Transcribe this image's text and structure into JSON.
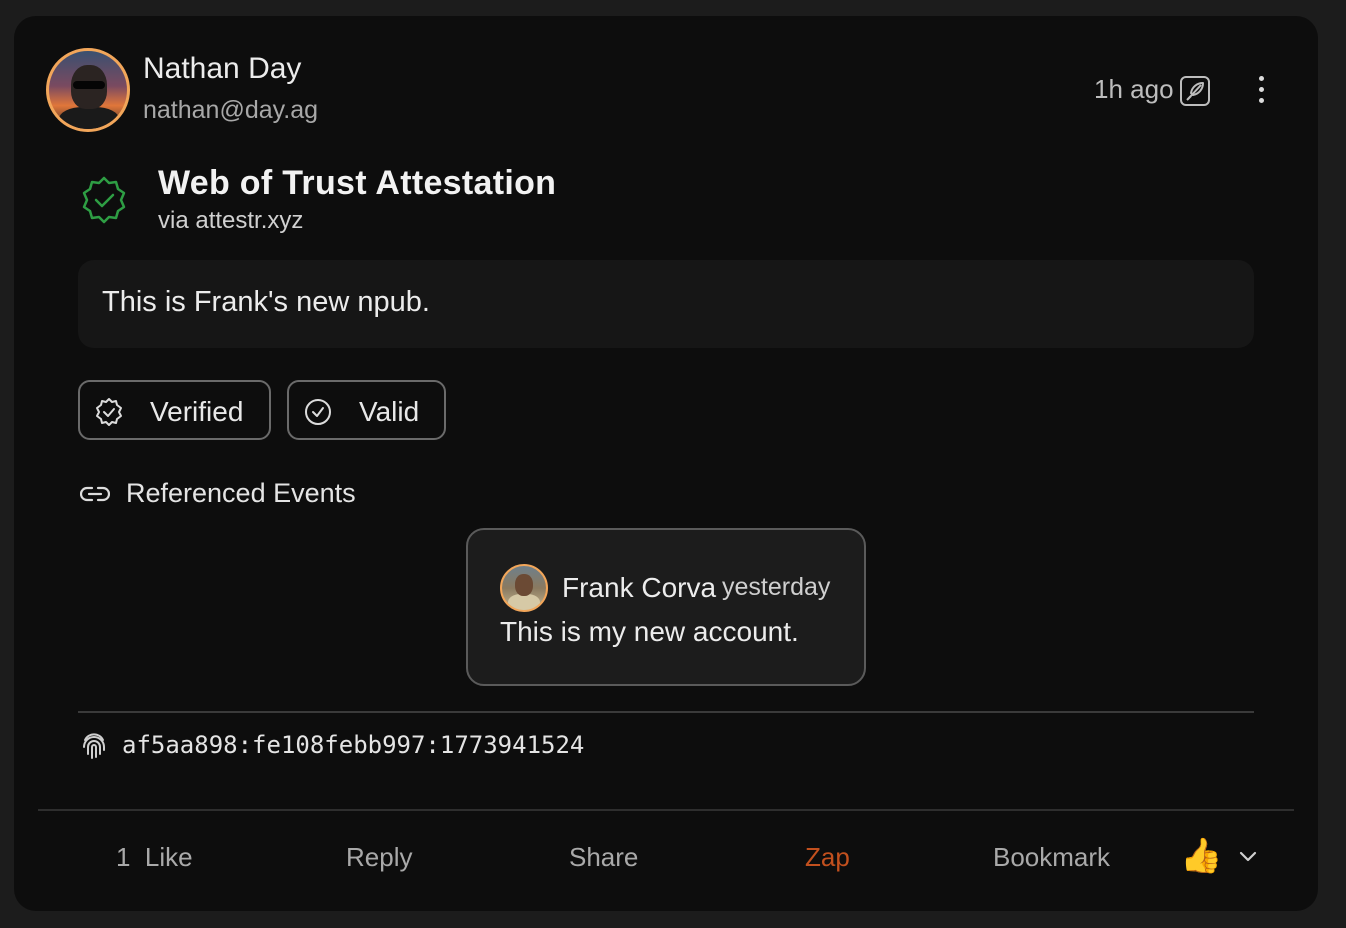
{
  "author": {
    "name": "Nathan Day",
    "nip05": "nathan@day.ag",
    "time": "1h ago",
    "avatar_icon": "user-avatar-photo"
  },
  "attestation": {
    "title": "Web of Trust Attestation",
    "via": "via attestr.xyz",
    "icon": "verified-badge-icon",
    "icon_color": "#2e9e44"
  },
  "content": "This is Frank's new npub.",
  "chips": {
    "verified": "Verified",
    "valid": "Valid"
  },
  "referenced": {
    "label": "Referenced Events",
    "event": {
      "author": "Frank Corva",
      "time": "yesterday",
      "text": "This is my new account."
    }
  },
  "coordinate": "af5aa898:fe108febb997:1773941524",
  "actions": {
    "like_count": "1",
    "like": "Like",
    "reply": "Reply",
    "share": "Share",
    "zap": "Zap",
    "bookmark": "Bookmark",
    "reaction_emoji": "👍"
  },
  "colors": {
    "zap": "#c2501e",
    "avatar_ring": "#f2a65a",
    "card_bg": "#0d0d0d"
  }
}
